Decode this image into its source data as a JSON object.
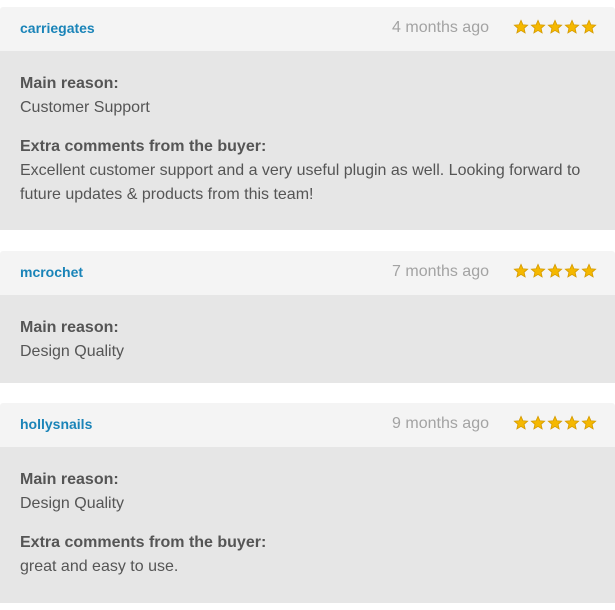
{
  "colors": {
    "username": "#1a84b8",
    "star": "#f5b800",
    "header_bg": "#f4f4f4",
    "body_bg": "#e6e6e6"
  },
  "labels": {
    "main_reason": "Main reason:",
    "extra_comments": "Extra comments from the buyer:"
  },
  "reviews": [
    {
      "username": "carriegates",
      "date": "4 months ago",
      "rating": 5,
      "max": 5,
      "main_reason": "Customer Support",
      "comment": "Excellent customer support and a very useful plugin as well. Looking forward to future updates & products from this team!"
    },
    {
      "username": "mcrochet",
      "date": "7 months ago",
      "rating": 5,
      "max": 5,
      "main_reason": "Design Quality"
    },
    {
      "username": "hollysnails",
      "date": "9 months ago",
      "rating": 5,
      "max": 5,
      "main_reason": "Design Quality",
      "comment": "great and easy to use."
    }
  ]
}
